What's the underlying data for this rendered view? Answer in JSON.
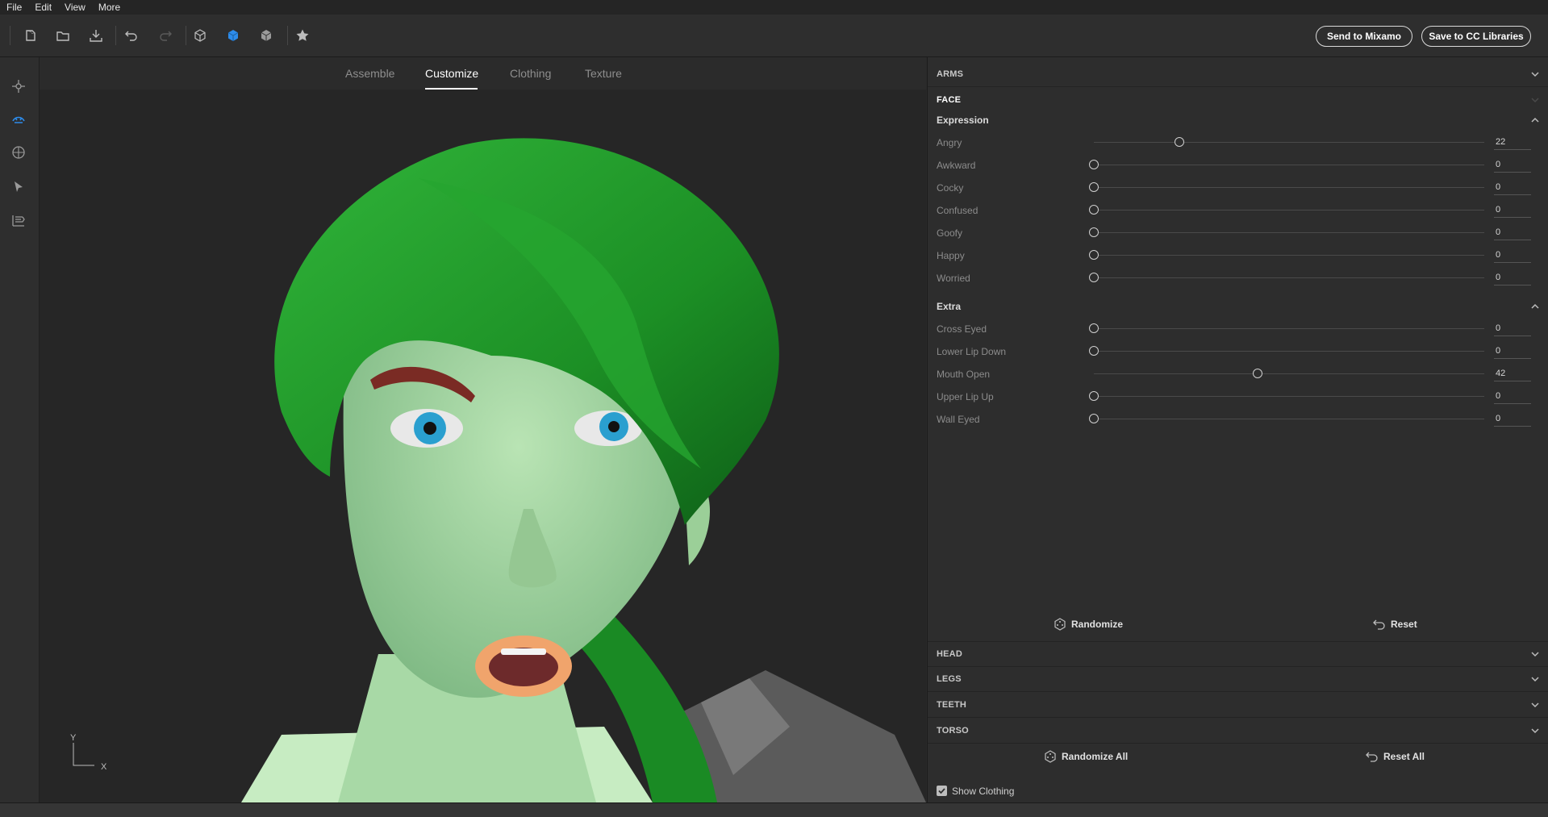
{
  "menu": [
    "File",
    "Edit",
    "View",
    "More"
  ],
  "toolbar": {
    "send_mixamo": "Send to Mixamo",
    "save_cc": "Save to CC Libraries",
    "accent": "#2d8ceb"
  },
  "tabs": [
    "Assemble",
    "Customize",
    "Clothing",
    "Texture"
  ],
  "active_tab": "Customize",
  "axis": {
    "y": "Y",
    "x": "X"
  },
  "panel": {
    "arms": "ARMS",
    "face": "FACE",
    "expression_title": "Expression",
    "expression": [
      {
        "label": "Angry",
        "value": "22",
        "level": 22
      },
      {
        "label": "Awkward",
        "value": "0",
        "level": 0
      },
      {
        "label": "Cocky",
        "value": "0",
        "level": 0
      },
      {
        "label": "Confused",
        "value": "0",
        "level": 0
      },
      {
        "label": "Goofy",
        "value": "0",
        "level": 0
      },
      {
        "label": "Happy",
        "value": "0",
        "level": 0
      },
      {
        "label": "Worried",
        "value": "0",
        "level": 0
      }
    ],
    "extra_title": "Extra",
    "extra": [
      {
        "label": "Cross Eyed",
        "value": "0",
        "level": 0
      },
      {
        "label": "Lower Lip Down",
        "value": "0",
        "level": 0
      },
      {
        "label": "Mouth Open",
        "value": "42",
        "level": 42
      },
      {
        "label": "Upper Lip Up",
        "value": "0",
        "level": 0
      },
      {
        "label": "Wall Eyed",
        "value": "0",
        "level": 0
      }
    ],
    "randomize": "Randomize",
    "reset": "Reset",
    "sections": [
      "HEAD",
      "LEGS",
      "TEETH",
      "TORSO"
    ],
    "randomize_all": "Randomize All",
    "reset_all": "Reset All",
    "show_clothing": "Show Clothing"
  }
}
